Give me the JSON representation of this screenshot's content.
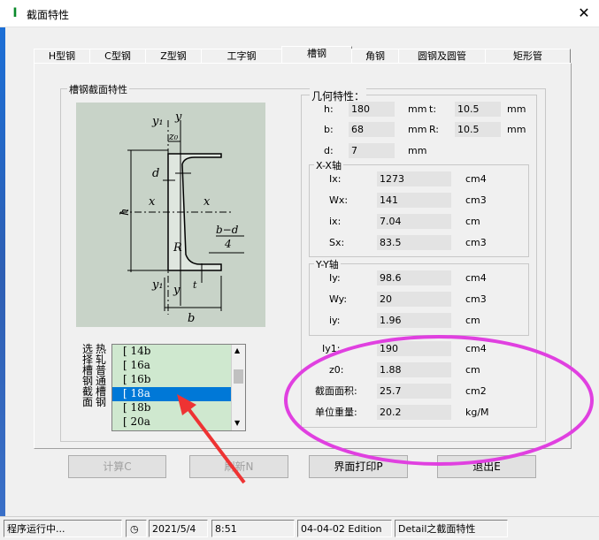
{
  "window": {
    "title": "截面特性",
    "close_glyph": "✕",
    "app_glyph": "I"
  },
  "tabs": [
    {
      "label": "H型钢"
    },
    {
      "label": "C型钢"
    },
    {
      "label": "Z型钢"
    },
    {
      "label": "工字钢"
    },
    {
      "label": "槽钢"
    },
    {
      "label": "角钢"
    },
    {
      "label": "圆钢及圆管"
    },
    {
      "label": "矩形管"
    }
  ],
  "section_group": {
    "label": "槽钢截面特性"
  },
  "geometry": {
    "label": "几何特性：",
    "h": {
      "label": "h:",
      "value": "180",
      "unit": "mm"
    },
    "t": {
      "label": "t:",
      "value": "10.5",
      "unit": "mm"
    },
    "b": {
      "label": "b:",
      "value": "68",
      "unit": "mm"
    },
    "R": {
      "label": "R:",
      "value": "10.5",
      "unit": "mm"
    },
    "d": {
      "label": "d:",
      "value": "7",
      "unit": "mm"
    }
  },
  "xx_axis": {
    "label": "X-X轴",
    "rows": [
      {
        "label": "Ix:",
        "value": "1273",
        "unit": "cm4"
      },
      {
        "label": "Wx:",
        "value": "141",
        "unit": "cm3"
      },
      {
        "label": "ix:",
        "value": "7.04",
        "unit": "cm"
      },
      {
        "label": "Sx:",
        "value": "83.5",
        "unit": "cm3"
      }
    ]
  },
  "yy_axis": {
    "label": "Y-Y轴",
    "rows": [
      {
        "label": "Iy:",
        "value": "98.6",
        "unit": "cm4"
      },
      {
        "label": "Wy:",
        "value": "20",
        "unit": "cm3"
      },
      {
        "label": "iy:",
        "value": "1.96",
        "unit": "cm"
      }
    ]
  },
  "extra": {
    "rows": [
      {
        "label": "Iy1:",
        "value": "190",
        "unit": "cm4"
      },
      {
        "label": "z0:",
        "value": "1.88",
        "unit": "cm"
      },
      {
        "label": "截面面积:",
        "value": "25.7",
        "unit": "cm2"
      },
      {
        "label": "单位重量:",
        "value": "20.2",
        "unit": "kg/M"
      }
    ]
  },
  "diagram_labels": {
    "y1_top": "y₁",
    "y_top": "y",
    "z0": "z₀",
    "d": "d",
    "h": "h",
    "x_left": "x",
    "x_right": "x",
    "bd4": "b−d",
    "four": "4",
    "R": "R",
    "t": "t",
    "y1_bot": "y₁",
    "y_bot": "y",
    "b": "b"
  },
  "selector_label_cols": [
    [
      "选",
      "择",
      "槽",
      "钢",
      "截",
      "面"
    ],
    [
      "热",
      "轧",
      "普",
      "通",
      "槽",
      "钢"
    ]
  ],
  "list": {
    "items": [
      "[ 14b",
      "[ 16a",
      "[ 16b",
      "[ 18a",
      "[ 18b",
      "[ 20a"
    ],
    "selected_index": 3
  },
  "buttons": {
    "calc": "计算C",
    "refresh": "刷新N",
    "print": "界面打印P",
    "exit": "退出E"
  },
  "status": {
    "running": "程序运行中...",
    "date": "2021/5/4",
    "time": "8:51",
    "edition": "04-04-02 Edition",
    "module": "Detail之截面特性"
  },
  "annotation_color": "#e040e0",
  "arrow_color": "#ee3333"
}
